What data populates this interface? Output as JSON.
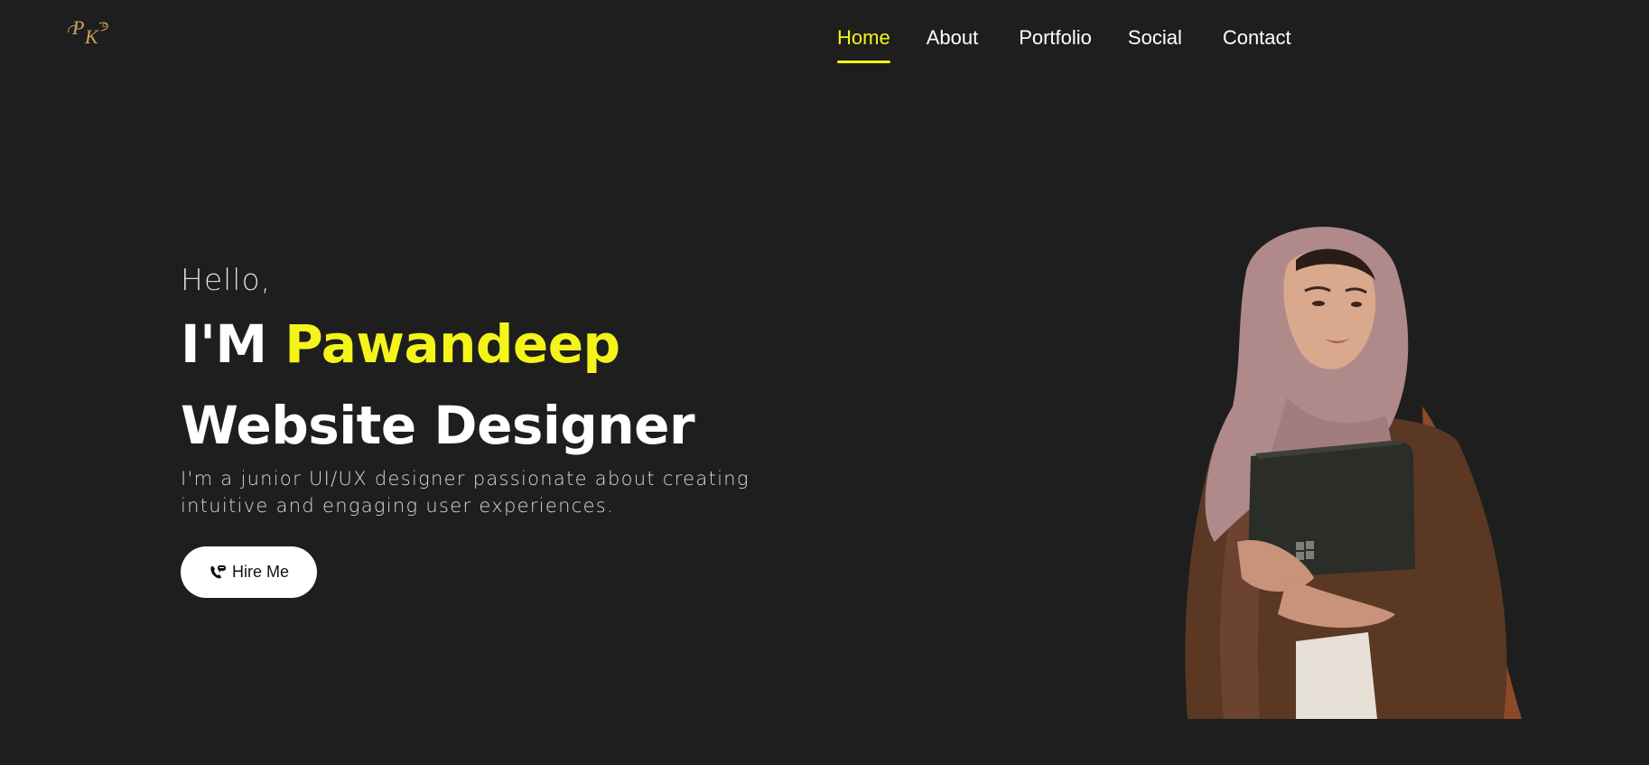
{
  "logo": {
    "text": "PK",
    "color": "#c9a35a"
  },
  "nav": {
    "items": [
      {
        "label": "Home",
        "active": true
      },
      {
        "label": "About",
        "active": false
      },
      {
        "label": "Portfolio",
        "active": false
      },
      {
        "label": "Social",
        "active": false
      },
      {
        "label": "Contact",
        "active": false
      }
    ]
  },
  "hero": {
    "greeting": "Hello,",
    "intro_prefix": "I'M",
    "name": "Pawandeep",
    "role": "Website Designer",
    "description": "I'm a junior UI/UX designer passionate about creating intuitive and engaging user experiences.",
    "cta_label": "Hire Me",
    "cta_icon": "phone-chat-icon"
  },
  "colors": {
    "background": "#1e1e1e",
    "accent": "#f4f41a",
    "text": "#ffffff"
  },
  "image": {
    "subject": "portrait-photo",
    "icon": "person-with-laptop"
  }
}
